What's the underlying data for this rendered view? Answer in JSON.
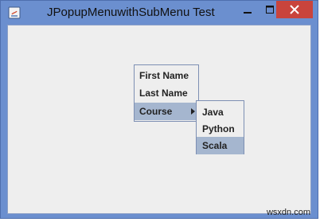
{
  "window": {
    "title": "JPopupMenuwithSubMenu Test",
    "accent_color": "#6b8fcf",
    "close_color": "#c9443c"
  },
  "popup_menu": {
    "items": [
      {
        "label": "First Name"
      },
      {
        "label": "Last Name"
      },
      {
        "label": "Course",
        "has_submenu": true,
        "selected": true
      }
    ]
  },
  "submenu": {
    "items": [
      {
        "label": "Java"
      },
      {
        "label": "Python"
      },
      {
        "label": "Scala",
        "selected": true
      }
    ]
  },
  "watermark": "wsxdn.com",
  "icons": {
    "app": "java-app-icon",
    "minimize": "minimize-icon",
    "maximize": "maximize-icon",
    "close": "close-icon",
    "submenu_arrow": "submenu-arrow-icon"
  }
}
